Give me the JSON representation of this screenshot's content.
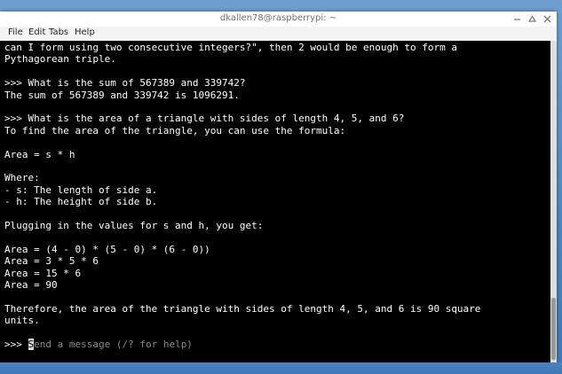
{
  "window": {
    "title": "dkallen78@raspberrypi: ~",
    "buttons": [
      "minimize-icon",
      "maximize-icon",
      "close-icon"
    ]
  },
  "menu": [
    "File",
    "Edit",
    "Tabs",
    "Help"
  ],
  "terminal": {
    "lines": [
      "can I form using two consecutive integers?\", then 2 would be enough to form a",
      "Pythagorean triple.",
      "",
      ">>> What is the sum of 567389 and 339742?",
      "The sum of 567389 and 339742 is 1096291.",
      "",
      ">>> What is the area of a triangle with sides of length 4, 5, and 6?",
      "To find the area of the triangle, you can use the formula:",
      "",
      "Area = s * h",
      "",
      "Where:",
      "- s: The length of side a.",
      "- h: The height of side b.",
      "",
      "Plugging in the values for s and h, you get:",
      "",
      "Area = (4 - 0) * (5 - 0) * (6 - 0))",
      "Area = 3 * 5 * 6",
      "Area = 15 * 6",
      "Area = 90",
      "",
      "Therefore, the area of the triangle with sides of length 4, 5, and 6 is 90 square",
      "units.",
      ""
    ],
    "prompt": ">>> ",
    "cursor_char": "S",
    "placeholder_rest": "end a message (/? for help)"
  },
  "colors": {
    "terminal_bg": "#000000",
    "terminal_fg": "#ffffff",
    "desktop": "#4f86c0"
  }
}
